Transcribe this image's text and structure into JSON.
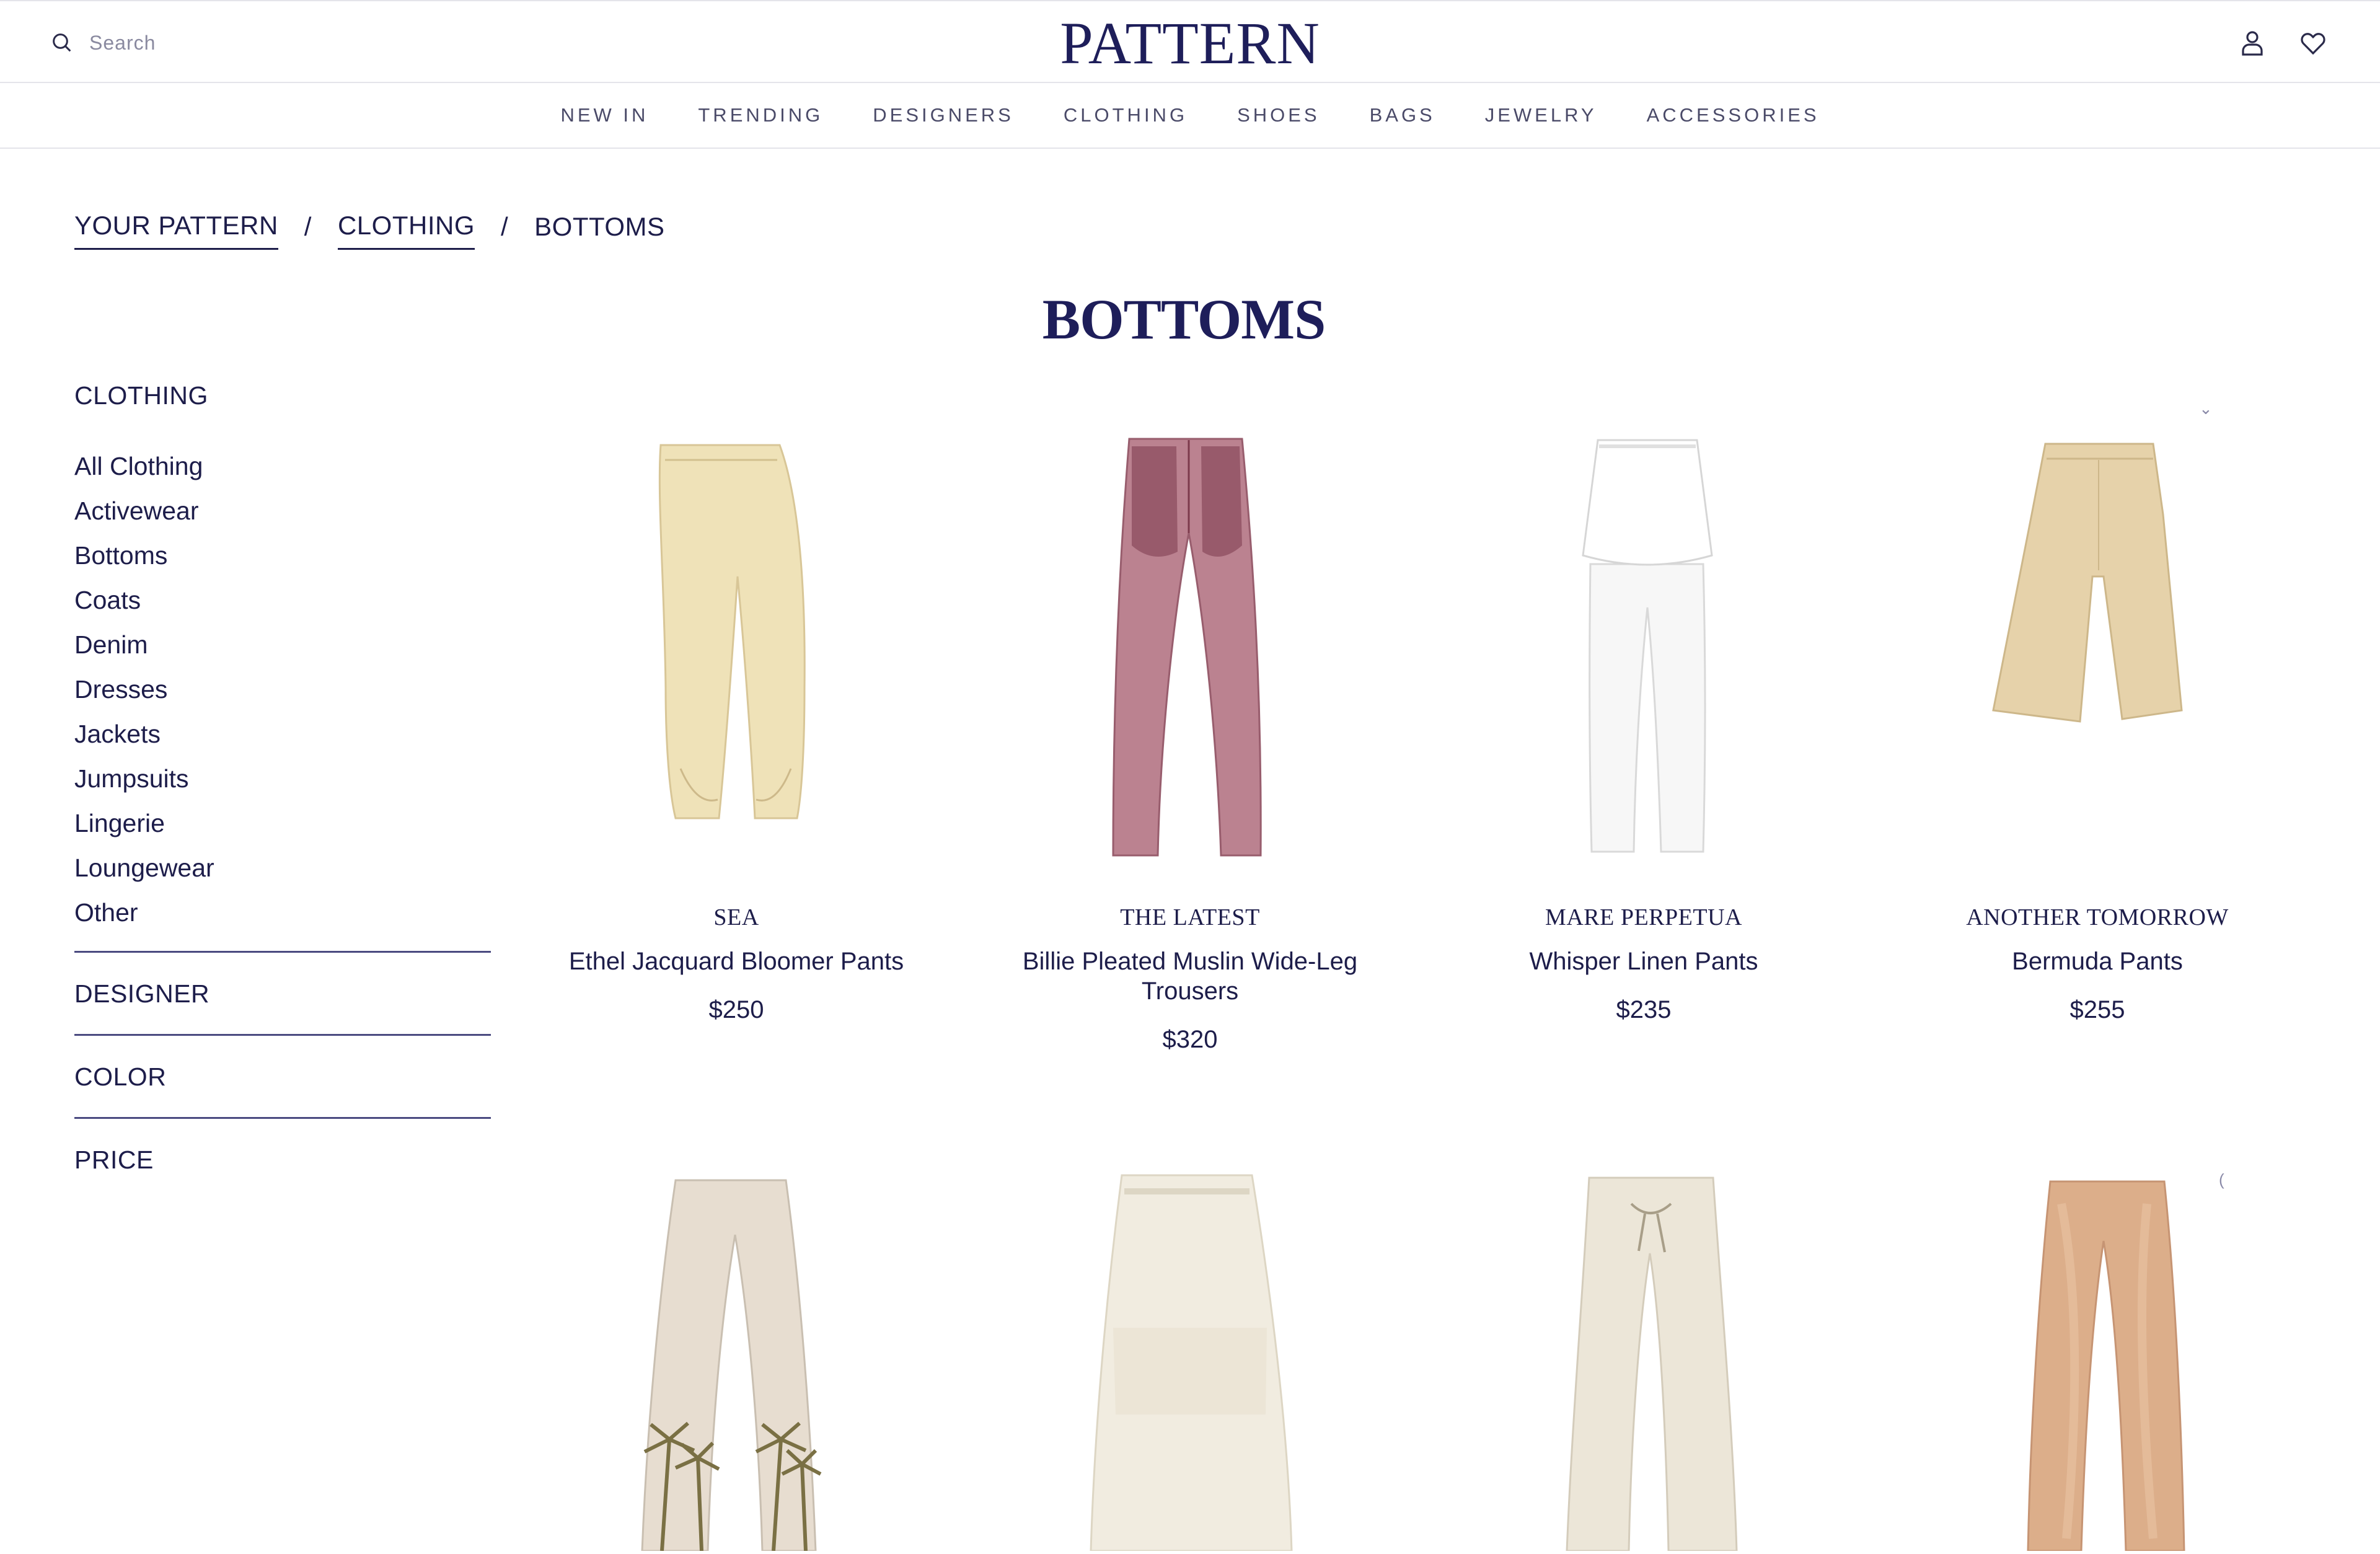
{
  "header": {
    "search_placeholder": "Search",
    "logo": "PATTERN"
  },
  "nav": [
    "NEW IN",
    "TRENDING",
    "DESIGNERS",
    "CLOTHING",
    "SHOES",
    "BAGS",
    "JEWELRY",
    "ACCESSORIES"
  ],
  "breadcrumb": {
    "items": [
      "YOUR PATTERN",
      "CLOTHING"
    ],
    "current": "BOTTOMS",
    "separator": "/"
  },
  "page_title": "BOTTOMS",
  "sidebar": {
    "heading": "CLOTHING",
    "categories": [
      "All Clothing",
      "Activewear",
      "Bottoms",
      "Coats",
      "Denim",
      "Dresses",
      "Jackets",
      "Jumpsuits",
      "Lingerie",
      "Loungewear",
      "Other"
    ],
    "filters": [
      "DESIGNER",
      "COLOR",
      "PRICE"
    ]
  },
  "products": [
    {
      "brand": "SEA",
      "name": "Ethel Jacquard Bloomer Pants",
      "price": "$250",
      "color": "#efe2b8"
    },
    {
      "brand": "THE LATEST",
      "name": "Billie Pleated Muslin Wide-Leg Trousers",
      "price": "$320",
      "color": "#b47584"
    },
    {
      "brand": "MARE PERPETUA",
      "name": "Whisper Linen Pants",
      "price": "$235",
      "color": "#f7f7f7"
    },
    {
      "brand": "ANOTHER TOMORROW",
      "name": "Bermuda Pants",
      "price": "$255",
      "color": "#e6d2aa"
    }
  ],
  "products_row2_colors": [
    "#e7ddd0",
    "#f1ece0",
    "#ece6d8",
    "#dcae8a"
  ],
  "theme": {
    "text": "#1d1d4a",
    "logo": "#1e1e5a",
    "nav_text": "#4a4a68",
    "rule": "#4a4a80"
  },
  "icons": [
    "search-icon",
    "account-icon",
    "wishlist-heart-icon",
    "chevron-down-icon"
  ]
}
